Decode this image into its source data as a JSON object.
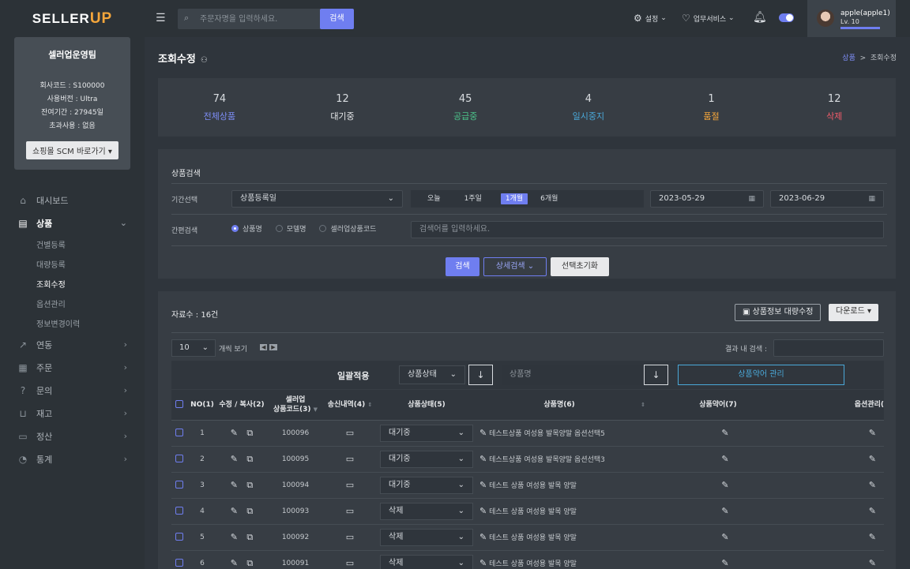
{
  "brand": {
    "logo_main": "SELLER",
    "logo_accent": "UP"
  },
  "team": {
    "name": "셀러업운영팀",
    "company_code": "회사코드 : S100000",
    "version": "사용버전 : Ultra",
    "remaining": "잔여기간 : 27945일",
    "overuse": "초과사용 : 없음",
    "scm_button": "쇼핑몰 SCM 바로가기"
  },
  "sidebar": {
    "items": [
      {
        "label": "대시보드",
        "icon": "home-icon"
      },
      {
        "label": "상품",
        "icon": "database-icon"
      },
      {
        "label": "연동",
        "icon": "share-icon"
      },
      {
        "label": "주문",
        "icon": "clipboard-icon"
      },
      {
        "label": "문의",
        "icon": "question-icon"
      },
      {
        "label": "재고",
        "icon": "basket-icon"
      },
      {
        "label": "정산",
        "icon": "folder-icon"
      },
      {
        "label": "통계",
        "icon": "chart-icon"
      }
    ],
    "subitems": [
      "건별등록",
      "대량등록",
      "조회수정",
      "옵션관리",
      "정보변경이력"
    ]
  },
  "topbar": {
    "search_placeholder": "주문자명을 입력하세요.",
    "search_button": "검색",
    "settings": "설정",
    "services": "업무서비스",
    "user_name": "apple(apple1)",
    "user_level": "Lv. 10"
  },
  "page": {
    "title": "조회수정",
    "breadcrumb_parent": "상품",
    "breadcrumb_sep": ">",
    "breadcrumb_current": "조회수정"
  },
  "stats": [
    {
      "value": "74",
      "label": "전체상품",
      "color": "#7d8df5"
    },
    {
      "value": "12",
      "label": "대기중",
      "color": "#e6e8ea"
    },
    {
      "value": "45",
      "label": "공급중",
      "color": "#4cc38a"
    },
    {
      "value": "4",
      "label": "일시중지",
      "color": "#4aa8d8"
    },
    {
      "value": "1",
      "label": "품절",
      "color": "#f4a63b"
    },
    {
      "value": "12",
      "label": "삭제",
      "color": "#f25c6a"
    }
  ],
  "search": {
    "title": "상품검색",
    "period_label": "기간선택",
    "period_select": "상품등록일",
    "periods": [
      "오늘",
      "1주일",
      "1개월",
      "6개월"
    ],
    "date_from": "2023-05-29",
    "date_to": "2023-06-29",
    "quick_label": "간편검색",
    "radios": [
      "상품명",
      "모델명",
      "셀러업상품코드"
    ],
    "keyword_placeholder": "검색어를 입력하세요.",
    "btn_search": "검색",
    "btn_detail": "상세검색",
    "btn_reset": "선택초기화"
  },
  "results": {
    "count": "자료수 : 16건",
    "bulk_edit": "상품정보 대량수정",
    "download": "다운로드",
    "page_size": "10",
    "page_size_label": "개씩 보기",
    "in_result_search": "결과 내 검색 :",
    "bulk_label": "일괄적용",
    "bulk_status": "상품상태",
    "bulk_name_placeholder": "상품명",
    "abbr_manage": "상품약어 관리",
    "headers": {
      "no": "NO(1)",
      "edit": "수정 / 복사(2)",
      "code1": "셀러업",
      "code2": "상품코드(3)",
      "send": "송신내역(4)",
      "status": "상품상태(5)",
      "name": "상품명(6)",
      "abbr": "상품약어(7)",
      "option": "옵션관리("
    },
    "rows": [
      {
        "no": "1",
        "code": "100096",
        "status": "대기중",
        "name": "테스트상품 여성용 발목양말 옵션선택5"
      },
      {
        "no": "2",
        "code": "100095",
        "status": "대기중",
        "name": "테스트상품 여성용 발목양말 옵션선택3"
      },
      {
        "no": "3",
        "code": "100094",
        "status": "대기중",
        "name": "테스트 상품 여성용 발목 양말"
      },
      {
        "no": "4",
        "code": "100093",
        "status": "삭제",
        "name": "테스트 상품 여성용 발목 양말"
      },
      {
        "no": "5",
        "code": "100092",
        "status": "삭제",
        "name": "테스트 상품 여성용 발목 양말"
      },
      {
        "no": "6",
        "code": "100091",
        "status": "삭제",
        "name": "테스트 상품 여성용 발목 양말"
      }
    ]
  }
}
